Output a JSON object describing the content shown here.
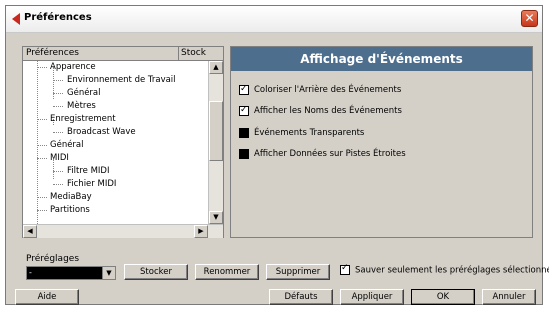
{
  "window": {
    "title": "Préférences",
    "close_symbol": "✕"
  },
  "tree": {
    "col_header": "Préférences",
    "col2_header": "Stock",
    "items": [
      {
        "label": "Apparence"
      },
      {
        "label": "Environnement de Travail"
      },
      {
        "label": "Général"
      },
      {
        "label": "Mètres"
      },
      {
        "label": "Enregistrement"
      },
      {
        "label": "Broadcast Wave"
      },
      {
        "label": "Général"
      },
      {
        "label": "MIDI"
      },
      {
        "label": "Filtre MIDI"
      },
      {
        "label": "Fichier MIDI"
      },
      {
        "label": "MediaBay"
      },
      {
        "label": "Partitions"
      }
    ],
    "scroll_up": "▲",
    "scroll_down": "▼",
    "scroll_left": "◀",
    "scroll_right": "▶"
  },
  "panel": {
    "title": "Affichage d'Événements",
    "options": [
      {
        "label": "Coloriser l'Arrière des Événements",
        "checked": true
      },
      {
        "label": "Afficher les Noms des Événements",
        "checked": true
      },
      {
        "label": "Événements Transparents",
        "checked": false
      },
      {
        "label": "Afficher Données sur Pistes Étroites",
        "checked": false
      }
    ]
  },
  "presets": {
    "label": "Préréglages",
    "value": "-",
    "arrow": "▼",
    "store": "Stocker",
    "rename": "Renommer",
    "delete": "Supprimer",
    "save_selected_label": "Sauver seulement les préréglages sélectionnés",
    "save_selected_checked": true
  },
  "footer": {
    "help": "Aide",
    "defaults": "Défauts",
    "apply": "Appliquer",
    "ok": "OK",
    "cancel": "Annuler"
  }
}
